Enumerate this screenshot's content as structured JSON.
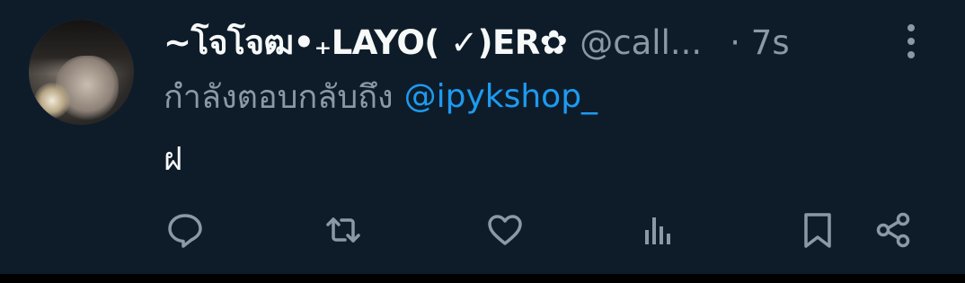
{
  "tweet": {
    "display_name": "~โจโจฒ•₊LAYO( ✓)ER✿",
    "handle": "@call...",
    "timestamp": "· 7s",
    "replying_prefix": "กำลังตอบกลับถึง",
    "replying_to": "@ipykshop_",
    "text": "ฝ"
  },
  "actions": [
    {
      "name": "reply",
      "icon": "speech-bubble-icon"
    },
    {
      "name": "retweet",
      "icon": "retweet-icon"
    },
    {
      "name": "like",
      "icon": "heart-icon"
    },
    {
      "name": "views",
      "icon": "bar-chart-icon"
    },
    {
      "name": "bookmark",
      "icon": "bookmark-icon"
    },
    {
      "name": "share",
      "icon": "share-icon"
    }
  ],
  "colors": {
    "background": "#0e1c2a",
    "primary_text": "#f7f9f9",
    "secondary_text": "#8b98a5",
    "accent": "#1d9bf0"
  }
}
